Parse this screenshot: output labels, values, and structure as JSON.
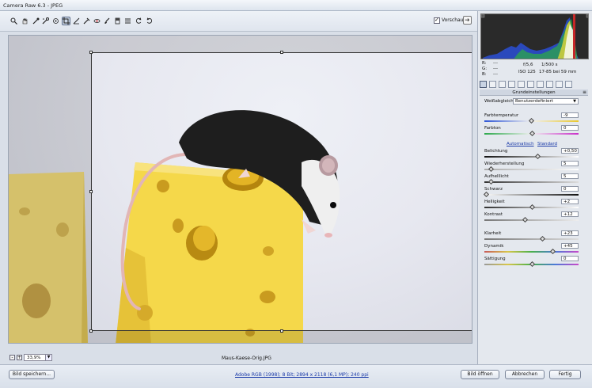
{
  "window": {
    "title": "Camera Raw 6.3 - JPEG"
  },
  "toolbar": {
    "tools": [
      {
        "name": "zoom-tool-icon"
      },
      {
        "name": "hand-tool-icon"
      },
      {
        "name": "white-balance-tool-icon"
      },
      {
        "name": "color-sampler-tool-icon"
      },
      {
        "name": "targeted-adjustment-tool-icon"
      },
      {
        "name": "crop-tool-icon",
        "active": true
      },
      {
        "name": "straighten-tool-icon"
      },
      {
        "name": "spot-removal-tool-icon"
      },
      {
        "name": "red-eye-removal-tool-icon"
      },
      {
        "name": "adjustment-brush-icon"
      },
      {
        "name": "graduated-filter-icon"
      },
      {
        "name": "preferences-icon"
      },
      {
        "name": "rotate-ccw-icon"
      },
      {
        "name": "rotate-cw-icon"
      }
    ],
    "preview_label": "Vorschau",
    "preview_checked": true
  },
  "canvas": {
    "filename": "Maus-Kaese-Orig.JPG",
    "zoom": "33,9%"
  },
  "info": {
    "r_label": "R:",
    "r_value": "---",
    "g_label": "G:",
    "g_value": "---",
    "b_label": "B:",
    "b_value": "---",
    "aperture": "f/5,6",
    "shutter": "1/500 s",
    "iso": "ISO 125",
    "lens": "17-85 bei 59 mm"
  },
  "panel": {
    "title": "Grundeinstellungen",
    "menu_icon": "≡",
    "wb_label": "Weißabgleich:",
    "wb_value": "Benutzerdefiniert",
    "auto_link": "Automatisch",
    "standard_link": "Standard",
    "controls": [
      {
        "label": "Farbtemperatur",
        "value": "-9",
        "fraction": 0.49
      },
      {
        "label": "Farbton",
        "value": "0",
        "fraction": 0.5
      },
      {
        "label": "Belichtung",
        "value": "+0,50",
        "fraction": 0.56
      },
      {
        "label": "Wiederherstellung",
        "value": "5",
        "fraction": 0.05
      },
      {
        "label": "Aufhelllicht",
        "value": "5",
        "fraction": 0.05
      },
      {
        "label": "Schwarz",
        "value": "0",
        "fraction": 0.0
      },
      {
        "label": "Helligkeit",
        "value": "+2",
        "fraction": 0.5
      },
      {
        "label": "Kontrast",
        "value": "+12",
        "fraction": 0.42
      },
      {
        "label": "Klarheit",
        "value": "+23",
        "fraction": 0.61
      },
      {
        "label": "Dynamik",
        "value": "+45",
        "fraction": 0.72
      },
      {
        "label": "Sättigung",
        "value": "0",
        "fraction": 0.5
      }
    ]
  },
  "bottom": {
    "save_label": "Bild speichern...",
    "info_link": "Adobe RGB (1998); 8 Bit; 2894 x 2118 (6,1 MP); 240 ppi",
    "open_label": "Bild öffnen",
    "cancel_label": "Abbrechen",
    "done_label": "Fertig"
  },
  "colors": {
    "accent": "#1a3aa8",
    "panel_bg": "#e4e8ee"
  }
}
